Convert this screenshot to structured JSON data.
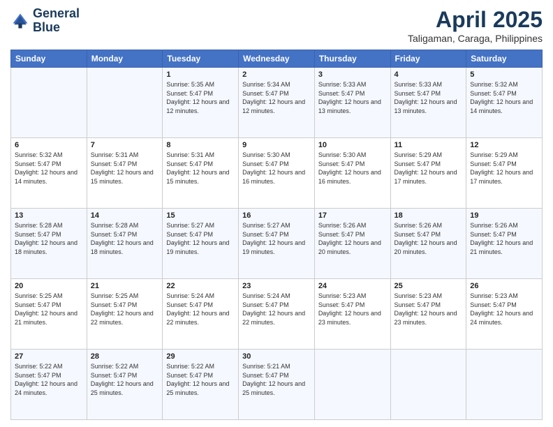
{
  "header": {
    "logo": {
      "line1": "General",
      "line2": "Blue"
    },
    "title": "April 2025",
    "location": "Taligaman, Caraga, Philippines"
  },
  "days_of_week": [
    "Sunday",
    "Monday",
    "Tuesday",
    "Wednesday",
    "Thursday",
    "Friday",
    "Saturday"
  ],
  "weeks": [
    [
      {
        "day": "",
        "sunrise": "",
        "sunset": "",
        "daylight": ""
      },
      {
        "day": "",
        "sunrise": "",
        "sunset": "",
        "daylight": ""
      },
      {
        "day": "1",
        "sunrise": "Sunrise: 5:35 AM",
        "sunset": "Sunset: 5:47 PM",
        "daylight": "Daylight: 12 hours and 12 minutes."
      },
      {
        "day": "2",
        "sunrise": "Sunrise: 5:34 AM",
        "sunset": "Sunset: 5:47 PM",
        "daylight": "Daylight: 12 hours and 12 minutes."
      },
      {
        "day": "3",
        "sunrise": "Sunrise: 5:33 AM",
        "sunset": "Sunset: 5:47 PM",
        "daylight": "Daylight: 12 hours and 13 minutes."
      },
      {
        "day": "4",
        "sunrise": "Sunrise: 5:33 AM",
        "sunset": "Sunset: 5:47 PM",
        "daylight": "Daylight: 12 hours and 13 minutes."
      },
      {
        "day": "5",
        "sunrise": "Sunrise: 5:32 AM",
        "sunset": "Sunset: 5:47 PM",
        "daylight": "Daylight: 12 hours and 14 minutes."
      }
    ],
    [
      {
        "day": "6",
        "sunrise": "Sunrise: 5:32 AM",
        "sunset": "Sunset: 5:47 PM",
        "daylight": "Daylight: 12 hours and 14 minutes."
      },
      {
        "day": "7",
        "sunrise": "Sunrise: 5:31 AM",
        "sunset": "Sunset: 5:47 PM",
        "daylight": "Daylight: 12 hours and 15 minutes."
      },
      {
        "day": "8",
        "sunrise": "Sunrise: 5:31 AM",
        "sunset": "Sunset: 5:47 PM",
        "daylight": "Daylight: 12 hours and 15 minutes."
      },
      {
        "day": "9",
        "sunrise": "Sunrise: 5:30 AM",
        "sunset": "Sunset: 5:47 PM",
        "daylight": "Daylight: 12 hours and 16 minutes."
      },
      {
        "day": "10",
        "sunrise": "Sunrise: 5:30 AM",
        "sunset": "Sunset: 5:47 PM",
        "daylight": "Daylight: 12 hours and 16 minutes."
      },
      {
        "day": "11",
        "sunrise": "Sunrise: 5:29 AM",
        "sunset": "Sunset: 5:47 PM",
        "daylight": "Daylight: 12 hours and 17 minutes."
      },
      {
        "day": "12",
        "sunrise": "Sunrise: 5:29 AM",
        "sunset": "Sunset: 5:47 PM",
        "daylight": "Daylight: 12 hours and 17 minutes."
      }
    ],
    [
      {
        "day": "13",
        "sunrise": "Sunrise: 5:28 AM",
        "sunset": "Sunset: 5:47 PM",
        "daylight": "Daylight: 12 hours and 18 minutes."
      },
      {
        "day": "14",
        "sunrise": "Sunrise: 5:28 AM",
        "sunset": "Sunset: 5:47 PM",
        "daylight": "Daylight: 12 hours and 18 minutes."
      },
      {
        "day": "15",
        "sunrise": "Sunrise: 5:27 AM",
        "sunset": "Sunset: 5:47 PM",
        "daylight": "Daylight: 12 hours and 19 minutes."
      },
      {
        "day": "16",
        "sunrise": "Sunrise: 5:27 AM",
        "sunset": "Sunset: 5:47 PM",
        "daylight": "Daylight: 12 hours and 19 minutes."
      },
      {
        "day": "17",
        "sunrise": "Sunrise: 5:26 AM",
        "sunset": "Sunset: 5:47 PM",
        "daylight": "Daylight: 12 hours and 20 minutes."
      },
      {
        "day": "18",
        "sunrise": "Sunrise: 5:26 AM",
        "sunset": "Sunset: 5:47 PM",
        "daylight": "Daylight: 12 hours and 20 minutes."
      },
      {
        "day": "19",
        "sunrise": "Sunrise: 5:26 AM",
        "sunset": "Sunset: 5:47 PM",
        "daylight": "Daylight: 12 hours and 21 minutes."
      }
    ],
    [
      {
        "day": "20",
        "sunrise": "Sunrise: 5:25 AM",
        "sunset": "Sunset: 5:47 PM",
        "daylight": "Daylight: 12 hours and 21 minutes."
      },
      {
        "day": "21",
        "sunrise": "Sunrise: 5:25 AM",
        "sunset": "Sunset: 5:47 PM",
        "daylight": "Daylight: 12 hours and 22 minutes."
      },
      {
        "day": "22",
        "sunrise": "Sunrise: 5:24 AM",
        "sunset": "Sunset: 5:47 PM",
        "daylight": "Daylight: 12 hours and 22 minutes."
      },
      {
        "day": "23",
        "sunrise": "Sunrise: 5:24 AM",
        "sunset": "Sunset: 5:47 PM",
        "daylight": "Daylight: 12 hours and 22 minutes."
      },
      {
        "day": "24",
        "sunrise": "Sunrise: 5:23 AM",
        "sunset": "Sunset: 5:47 PM",
        "daylight": "Daylight: 12 hours and 23 minutes."
      },
      {
        "day": "25",
        "sunrise": "Sunrise: 5:23 AM",
        "sunset": "Sunset: 5:47 PM",
        "daylight": "Daylight: 12 hours and 23 minutes."
      },
      {
        "day": "26",
        "sunrise": "Sunrise: 5:23 AM",
        "sunset": "Sunset: 5:47 PM",
        "daylight": "Daylight: 12 hours and 24 minutes."
      }
    ],
    [
      {
        "day": "27",
        "sunrise": "Sunrise: 5:22 AM",
        "sunset": "Sunset: 5:47 PM",
        "daylight": "Daylight: 12 hours and 24 minutes."
      },
      {
        "day": "28",
        "sunrise": "Sunrise: 5:22 AM",
        "sunset": "Sunset: 5:47 PM",
        "daylight": "Daylight: 12 hours and 25 minutes."
      },
      {
        "day": "29",
        "sunrise": "Sunrise: 5:22 AM",
        "sunset": "Sunset: 5:47 PM",
        "daylight": "Daylight: 12 hours and 25 minutes."
      },
      {
        "day": "30",
        "sunrise": "Sunrise: 5:21 AM",
        "sunset": "Sunset: 5:47 PM",
        "daylight": "Daylight: 12 hours and 25 minutes."
      },
      {
        "day": "",
        "sunrise": "",
        "sunset": "",
        "daylight": ""
      },
      {
        "day": "",
        "sunrise": "",
        "sunset": "",
        "daylight": ""
      },
      {
        "day": "",
        "sunrise": "",
        "sunset": "",
        "daylight": ""
      }
    ]
  ]
}
